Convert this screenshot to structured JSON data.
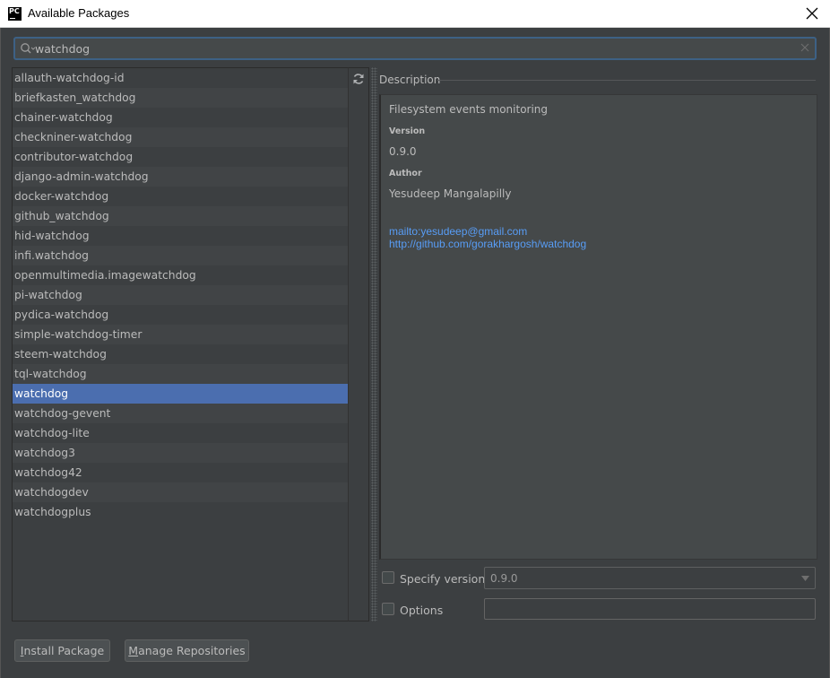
{
  "window": {
    "title": "Available Packages",
    "app_icon_text": "PC"
  },
  "search": {
    "value": "watchdog"
  },
  "packages": [
    "allauth-watchdog-id",
    "briefkasten_watchdog",
    "chainer-watchdog",
    "checkniner-watchdog",
    "contributor-watchdog",
    "django-admin-watchdog",
    "docker-watchdog",
    "github_watchdog",
    "hid-watchdog",
    "infi.watchdog",
    "openmultimedia.imagewatchdog",
    "pi-watchdog",
    "pydica-watchdog",
    "simple-watchdog-timer",
    "steem-watchdog",
    "tql-watchdog",
    "watchdog",
    "watchdog-gevent",
    "watchdog-lite",
    "watchdog3",
    "watchdog42",
    "watchdogdev",
    "watchdogplus"
  ],
  "selected_package": "watchdog",
  "description": {
    "header": "Description",
    "summary": "Filesystem events monitoring",
    "version_label": "Version",
    "version_value": "0.9.0",
    "author_label": "Author",
    "author_value": "Yesudeep Mangalapilly",
    "links": [
      "mailto:yesudeep@gmail.com",
      "http://github.com/gorakhargosh/watchdog"
    ]
  },
  "options": {
    "specify_version_label": "Specify version",
    "specify_version_checked": false,
    "version_selected": "0.9.0",
    "options_label": "Options",
    "options_checked": false,
    "options_value": ""
  },
  "buttons": {
    "install_mnemonic": "I",
    "install_rest": "nstall Package",
    "manage_mnemonic": "M",
    "manage_rest": "anage Repositories"
  },
  "icons": {
    "app": "pycharm-icon",
    "close": "close-icon",
    "search": "search-icon",
    "clear": "clear-icon",
    "refresh": "refresh-icon",
    "dropdown": "chevron-down-icon"
  },
  "colors": {
    "background": "#3c3f41",
    "selection": "#4b6eaf",
    "link": "#589df6",
    "focus_border": "#3d6185"
  }
}
